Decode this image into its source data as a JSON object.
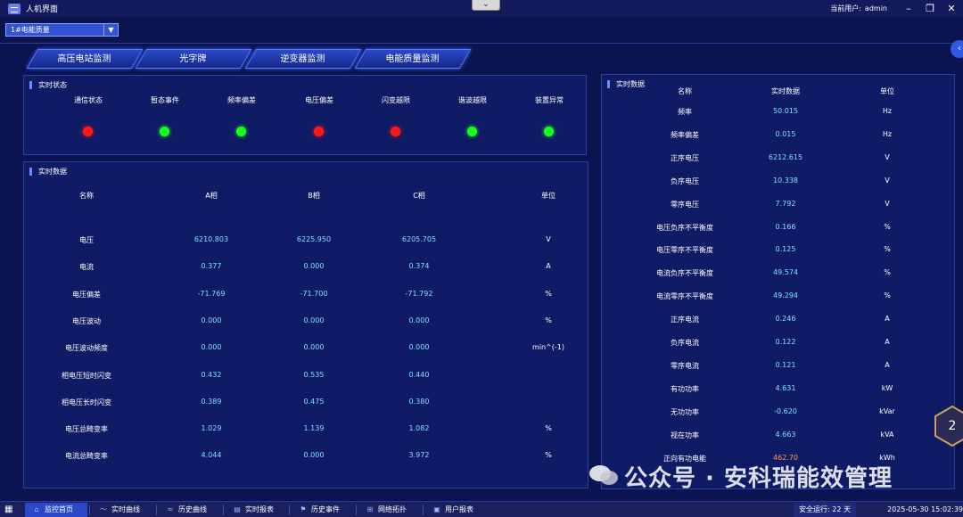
{
  "window": {
    "title": "人机界面",
    "user_label": "当前用户:",
    "user_name": "admin"
  },
  "station_select": {
    "value": "1#电能质量"
  },
  "nav": [
    "高压电站监测",
    "光字牌",
    "逆变器监测",
    "电能质量监测"
  ],
  "status_panel": {
    "title": "实时状态",
    "items": [
      {
        "label": "通信状态",
        "color": "#ff1a1a"
      },
      {
        "label": "暂态事件",
        "color": "#1aff1a"
      },
      {
        "label": "频率偏差",
        "color": "#1aff1a"
      },
      {
        "label": "电压偏差",
        "color": "#ff1a1a"
      },
      {
        "label": "闪变越限",
        "color": "#ff1a1a"
      },
      {
        "label": "谐波越限",
        "color": "#1aff1a"
      },
      {
        "label": "装置异常",
        "color": "#1aff1a"
      }
    ]
  },
  "phase_panel": {
    "title": "实时数据",
    "headers": [
      "名称",
      "A相",
      "B相",
      "C相",
      "单位"
    ],
    "rows": [
      {
        "name": "电压",
        "a": "6210.803",
        "b": "6225.950",
        "c": "6205.705",
        "unit": "V"
      },
      {
        "name": "电流",
        "a": "0.377",
        "b": "0.000",
        "c": "0.374",
        "unit": "A"
      },
      {
        "name": "电压偏差",
        "a": "-71.769",
        "b": "-71.700",
        "c": "-71.792",
        "unit": "%"
      },
      {
        "name": "电压波动",
        "a": "0.000",
        "b": "0.000",
        "c": "0.000",
        "unit": "%"
      },
      {
        "name": "电压波动频度",
        "a": "0.000",
        "b": "0.000",
        "c": "0.000",
        "unit": "min^(-1)"
      },
      {
        "name": "相电压短时闪变",
        "a": "0.432",
        "b": "0.535",
        "c": "0.440",
        "unit": ""
      },
      {
        "name": "相电压长时闪变",
        "a": "0.389",
        "b": "0.475",
        "c": "0.380",
        "unit": ""
      },
      {
        "name": "电压总畸变率",
        "a": "1.029",
        "b": "1.139",
        "c": "1.082",
        "unit": "%"
      },
      {
        "name": "电流总畸变率",
        "a": "4.044",
        "b": "0.000",
        "c": "3.972",
        "unit": "%"
      }
    ]
  },
  "right_panel": {
    "title": "实时数据",
    "headers": [
      "名称",
      "实时数据",
      "单位"
    ],
    "rows": [
      {
        "name": "频率",
        "value": "50.015",
        "unit": "Hz"
      },
      {
        "name": "频率偏差",
        "value": "0.015",
        "unit": "Hz"
      },
      {
        "name": "正序电压",
        "value": "6212.615",
        "unit": "V"
      },
      {
        "name": "负序电压",
        "value": "10.338",
        "unit": "V"
      },
      {
        "name": "零序电压",
        "value": "7.792",
        "unit": "V"
      },
      {
        "name": "电压负序不平衡度",
        "value": "0.166",
        "unit": "%"
      },
      {
        "name": "电压零序不平衡度",
        "value": "0.125",
        "unit": "%"
      },
      {
        "name": "电流负序不平衡度",
        "value": "49.574",
        "unit": "%"
      },
      {
        "name": "电流零序不平衡度",
        "value": "49.294",
        "unit": "%"
      },
      {
        "name": "正序电流",
        "value": "0.246",
        "unit": "A"
      },
      {
        "name": "负序电流",
        "value": "0.122",
        "unit": "A"
      },
      {
        "name": "零序电流",
        "value": "0.121",
        "unit": "A"
      },
      {
        "name": "有功功率",
        "value": "4.631",
        "unit": "kW"
      },
      {
        "name": "无功功率",
        "value": "-0.620",
        "unit": "kVar"
      },
      {
        "name": "视在功率",
        "value": "4.663",
        "unit": "kVA"
      },
      {
        "name": "正向有功电能",
        "value": "462.70",
        "unit": "kWh"
      }
    ]
  },
  "taskbar": {
    "items": [
      {
        "label": "监控首页",
        "icon": "home-icon"
      },
      {
        "label": "实时曲线",
        "icon": "chart-icon"
      },
      {
        "label": "历史曲线",
        "icon": "history-icon"
      },
      {
        "label": "实时报表",
        "icon": "report-icon"
      },
      {
        "label": "历史事件",
        "icon": "event-icon"
      },
      {
        "label": "网络拓扑",
        "icon": "network-icon"
      },
      {
        "label": "用户报表",
        "icon": "user-report-icon"
      }
    ],
    "status": "安全运行: 22 天",
    "time": "2025-05-30 15:02:39"
  },
  "watermark": "公众号 · 安科瑞能效管理",
  "hex_badge": "2"
}
